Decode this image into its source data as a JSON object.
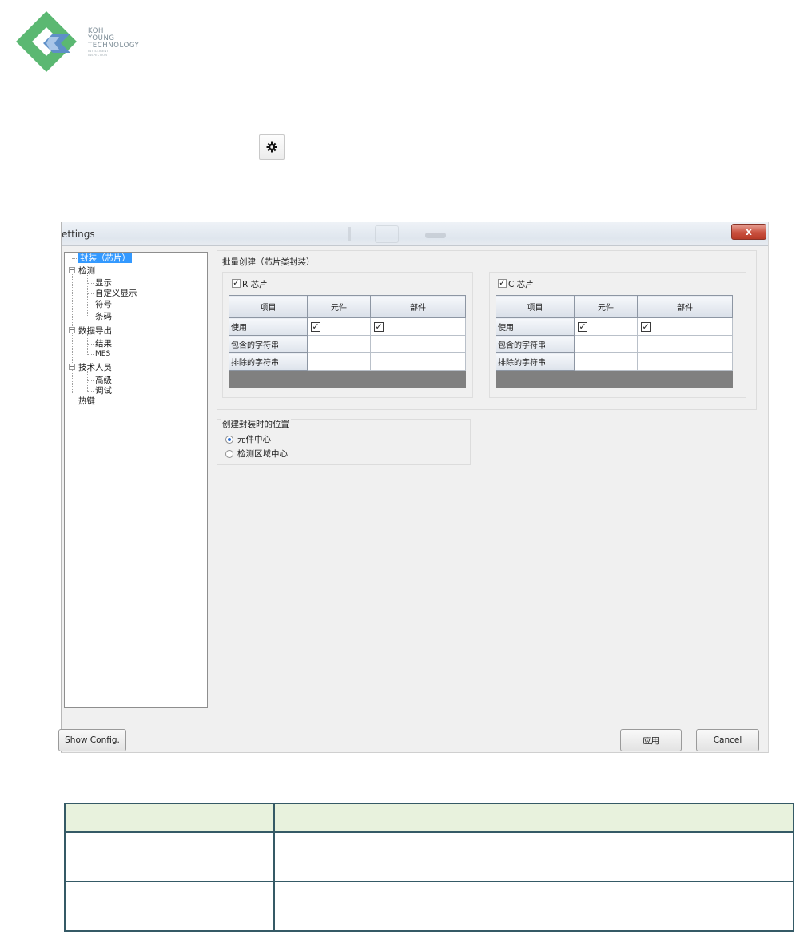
{
  "logo": {
    "line1": "KOH",
    "line2": "YOUNG",
    "line3": "TECHNOLOGY",
    "tagline1": "INTELLIGENT",
    "tagline2": "INSPECTION"
  },
  "window": {
    "title": "ettings",
    "close_label": "x",
    "tree": [
      {
        "label": "封装（芯片）",
        "selected": true
      },
      {
        "label": "检测",
        "expander": "−"
      },
      {
        "label": "显示"
      },
      {
        "label": "自定义显示"
      },
      {
        "label": "符号"
      },
      {
        "label": "条码"
      },
      {
        "label": "数据导出",
        "expander": "−"
      },
      {
        "label": "结果"
      },
      {
        "label": "MES"
      },
      {
        "label": "技术人员",
        "expander": "−"
      },
      {
        "label": "高级"
      },
      {
        "label": "调试"
      },
      {
        "label": "热键"
      }
    ],
    "batch_group_label": "批量创建（芯片类封装）",
    "r_chip": {
      "label": "R 芯片",
      "checked": true
    },
    "c_chip": {
      "label": "C 芯片",
      "checked": true
    },
    "grid_headers": [
      "项目",
      "元件",
      "部件"
    ],
    "grid_rows": [
      {
        "label": "使用",
        "comp": "✓",
        "part": "✓"
      },
      {
        "label": "包含的字符串",
        "comp": "",
        "part": ""
      },
      {
        "label": "排除的字符串",
        "comp": "",
        "part": ""
      }
    ],
    "position_group_label": "创建封装时的位置",
    "radio_options": [
      {
        "label": "元件中心",
        "selected": true
      },
      {
        "label": "检测区域中心",
        "selected": false
      }
    ],
    "buttons": {
      "show_config": "Show Config.",
      "apply": "应用",
      "cancel": "Cancel"
    }
  },
  "colors": {
    "logo_green": "#5bb872",
    "logo_blue": "#5e8fc8",
    "selection": "#3399ff",
    "doc_header": "#e8f2dd",
    "doc_border": "#355a66"
  }
}
